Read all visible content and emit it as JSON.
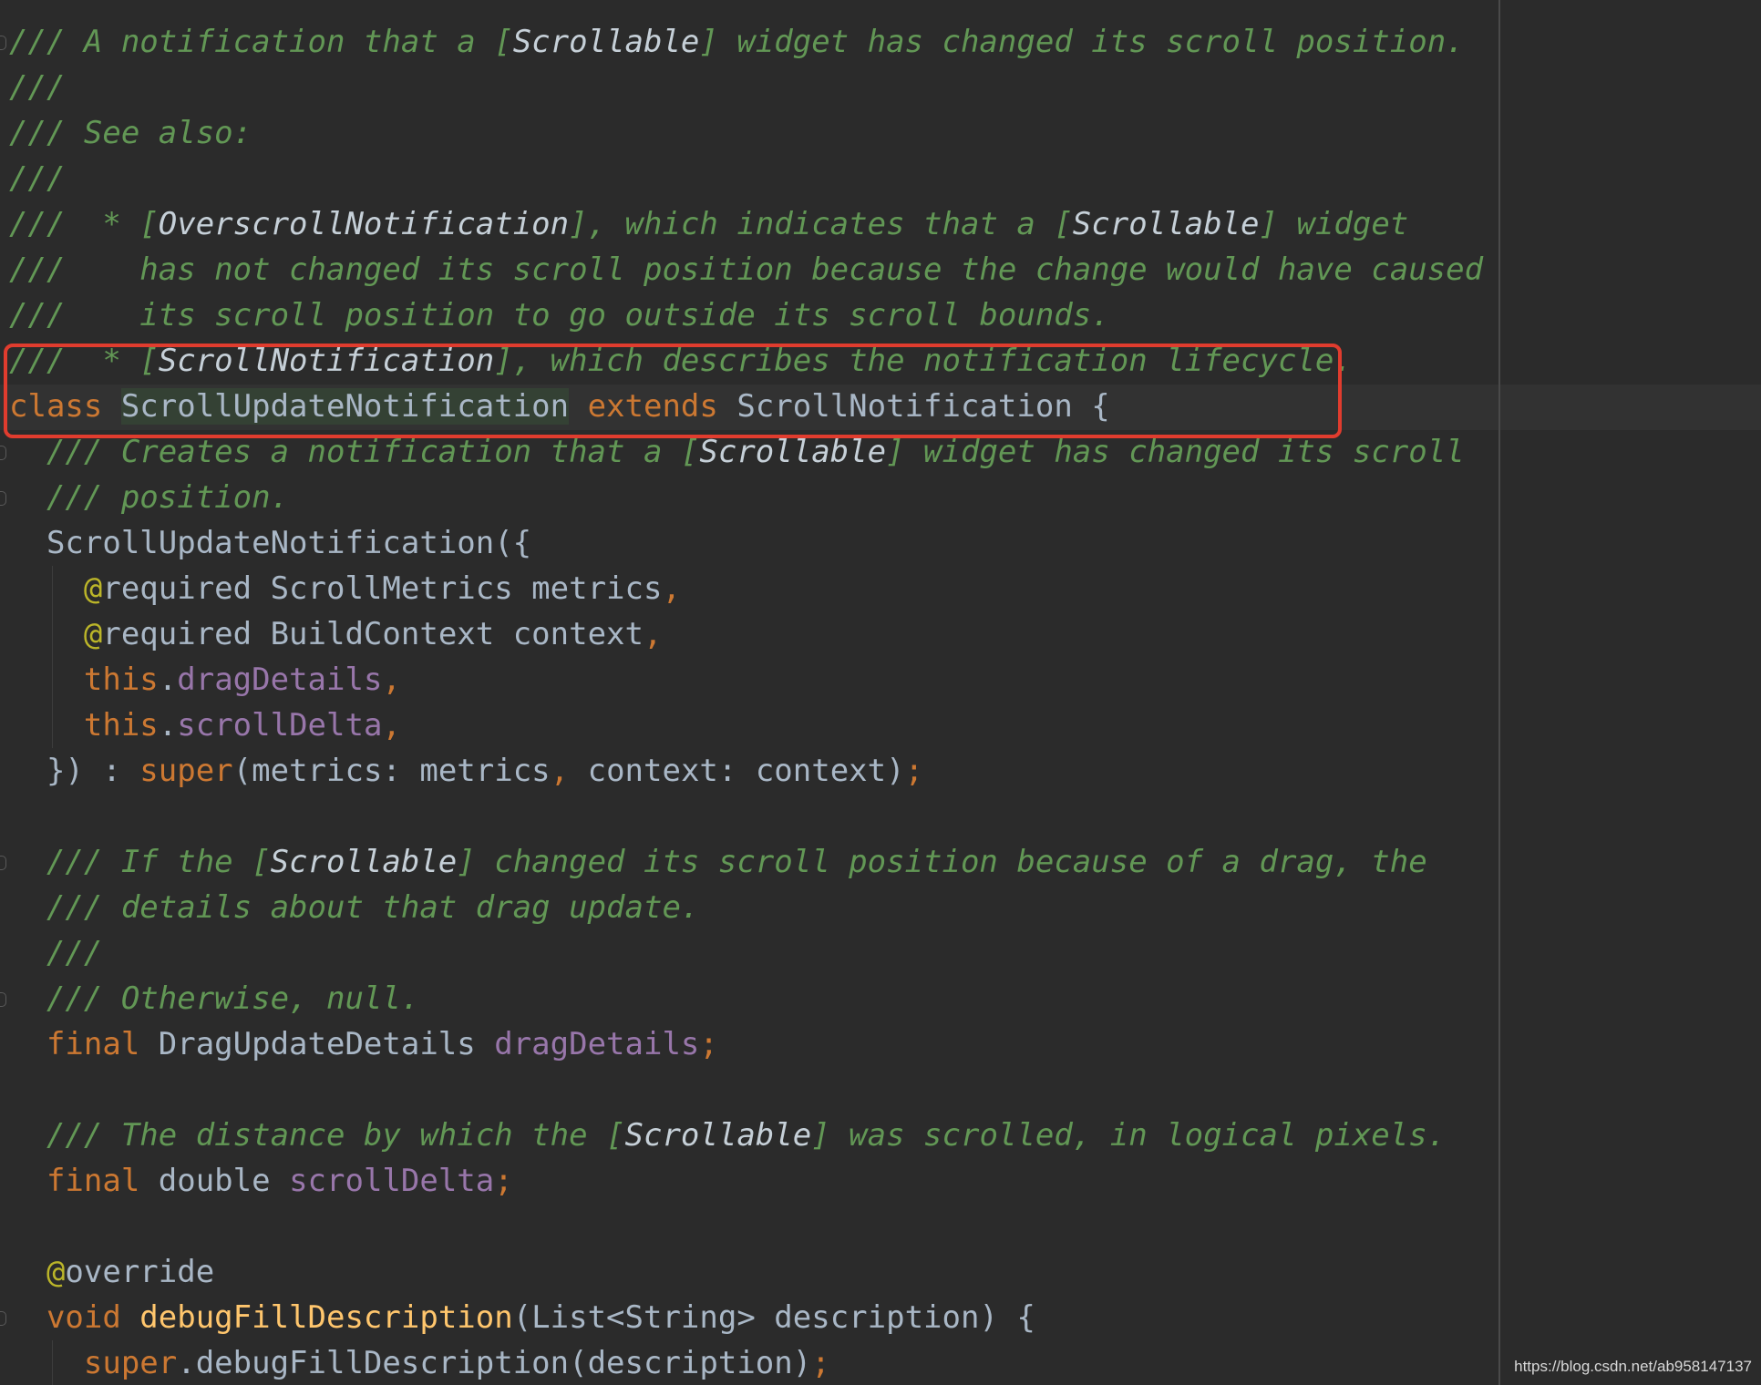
{
  "colors": {
    "background": "#2b2b2b",
    "doc_comment": "#629755",
    "keyword": "#cc7832",
    "field": "#9876aa",
    "annotation": "#bbb529",
    "method": "#ffc66d",
    "identifier": "#a9b7c6",
    "highlight_border": "#e03c2e"
  },
  "code": {
    "lines": [
      [
        {
          "s": "c",
          "t": "/// A notification that a ["
        },
        {
          "s": "cr",
          "t": "Scrollable"
        },
        {
          "s": "c",
          "t": "] widget has changed its scroll position."
        }
      ],
      [
        {
          "s": "c",
          "t": "///"
        }
      ],
      [
        {
          "s": "c",
          "t": "/// See also:"
        }
      ],
      [
        {
          "s": "c",
          "t": "///"
        }
      ],
      [
        {
          "s": "c",
          "t": "///  * ["
        },
        {
          "s": "cr",
          "t": "OverscrollNotification"
        },
        {
          "s": "c",
          "t": "], which indicates that a ["
        },
        {
          "s": "cr",
          "t": "Scrollable"
        },
        {
          "s": "c",
          "t": "] widget"
        }
      ],
      [
        {
          "s": "c",
          "t": "///    has not changed its scroll position because the change would have caused"
        }
      ],
      [
        {
          "s": "c",
          "t": "///    its scroll position to go outside its scroll bounds."
        }
      ],
      [
        {
          "s": "c",
          "t": "///  * ["
        },
        {
          "s": "cr",
          "t": "ScrollNotification"
        },
        {
          "s": "c",
          "t": "], which describes the notification lifecycle."
        }
      ],
      [
        {
          "s": "k",
          "t": "class "
        },
        {
          "s": "hl",
          "t": "ScrollUpdateNotification"
        },
        {
          "s": "k",
          "t": " extends "
        },
        {
          "s": "t",
          "t": "ScrollNotification {"
        }
      ],
      [
        {
          "s": "c",
          "t": "  /// Creates a notification that a ["
        },
        {
          "s": "cr",
          "t": "Scrollable"
        },
        {
          "s": "c",
          "t": "] widget has changed its scroll"
        }
      ],
      [
        {
          "s": "c",
          "t": "  /// position."
        }
      ],
      [
        {
          "s": "t",
          "t": "  ScrollUpdateNotification({"
        }
      ],
      [
        {
          "s": "a",
          "t": "    @"
        },
        {
          "s": "t",
          "t": "required ScrollMetrics metrics"
        },
        {
          "s": "k",
          "t": ","
        }
      ],
      [
        {
          "s": "a",
          "t": "    @"
        },
        {
          "s": "t",
          "t": "required BuildContext context"
        },
        {
          "s": "k",
          "t": ","
        }
      ],
      [
        {
          "s": "k",
          "t": "    this"
        },
        {
          "s": "t",
          "t": "."
        },
        {
          "s": "f",
          "t": "dragDetails"
        },
        {
          "s": "k",
          "t": ","
        }
      ],
      [
        {
          "s": "k",
          "t": "    this"
        },
        {
          "s": "t",
          "t": "."
        },
        {
          "s": "f",
          "t": "scrollDelta"
        },
        {
          "s": "k",
          "t": ","
        }
      ],
      [
        {
          "s": "t",
          "t": "  }) : "
        },
        {
          "s": "k",
          "t": "super"
        },
        {
          "s": "t",
          "t": "(metrics: metrics"
        },
        {
          "s": "k",
          "t": ", "
        },
        {
          "s": "t",
          "t": "context: context)"
        },
        {
          "s": "k",
          "t": ";"
        }
      ],
      [],
      [
        {
          "s": "c",
          "t": "  /// If the ["
        },
        {
          "s": "cr",
          "t": "Scrollable"
        },
        {
          "s": "c",
          "t": "] changed its scroll position because of a drag, the"
        }
      ],
      [
        {
          "s": "c",
          "t": "  /// details about that drag update."
        }
      ],
      [
        {
          "s": "c",
          "t": "  ///"
        }
      ],
      [
        {
          "s": "c",
          "t": "  /// Otherwise, null."
        }
      ],
      [
        {
          "s": "k",
          "t": "  final "
        },
        {
          "s": "t",
          "t": "DragUpdateDetails "
        },
        {
          "s": "f",
          "t": "dragDetails"
        },
        {
          "s": "k",
          "t": ";"
        }
      ],
      [],
      [
        {
          "s": "c",
          "t": "  /// The distance by which the ["
        },
        {
          "s": "cr",
          "t": "Scrollable"
        },
        {
          "s": "c",
          "t": "] was scrolled, in logical pixels."
        }
      ],
      [
        {
          "s": "k",
          "t": "  final "
        },
        {
          "s": "t",
          "t": "double "
        },
        {
          "s": "f",
          "t": "scrollDelta"
        },
        {
          "s": "k",
          "t": ";"
        }
      ],
      [],
      [
        {
          "s": "a",
          "t": "  @"
        },
        {
          "s": "t",
          "t": "override"
        }
      ],
      [
        {
          "s": "k",
          "t": "  void "
        },
        {
          "s": "m",
          "t": "debugFillDescription"
        },
        {
          "s": "t",
          "t": "(List<String> description) {"
        }
      ],
      [
        {
          "s": "k",
          "t": "    super"
        },
        {
          "s": "t",
          "t": ".debugFillDescription(description)"
        },
        {
          "s": "k",
          "t": ";"
        }
      ]
    ]
  },
  "watermark": "https://blog.csdn.net/ab958147137"
}
